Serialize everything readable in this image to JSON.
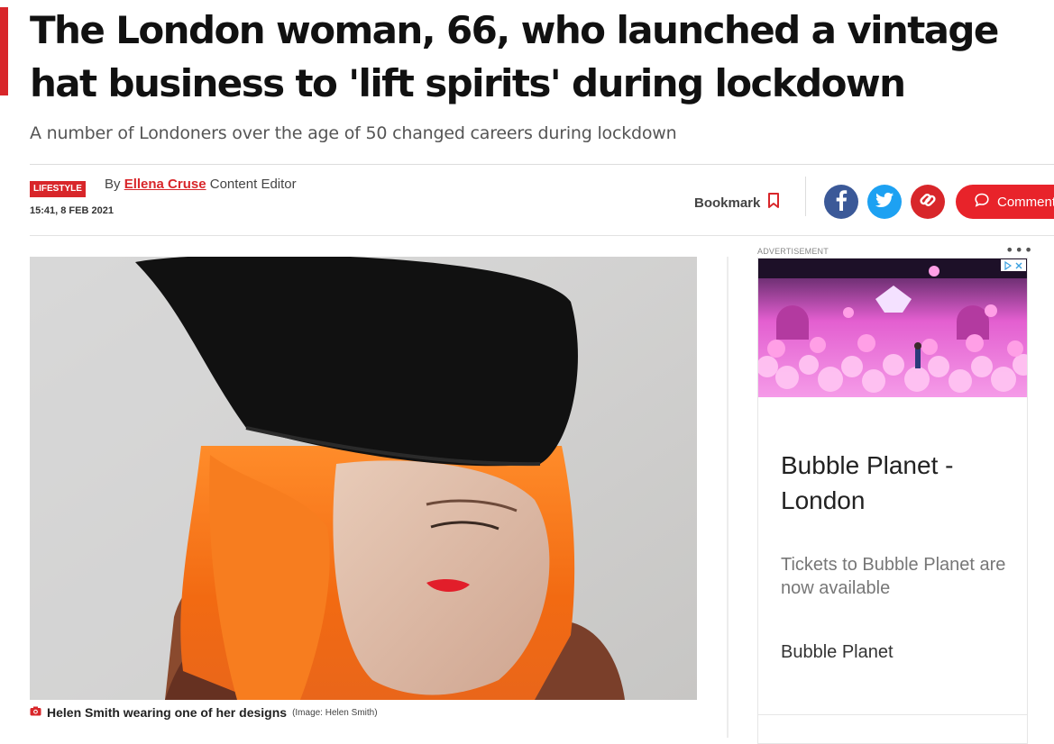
{
  "article": {
    "headline": "The London woman, 66, who launched a vintage hat business to 'lift spirits' during lockdown",
    "standfirst": "A number of Londoners over the age of 50 changed careers during lockdown",
    "section_badge": "LIFESTYLE",
    "byline_prefix": "By",
    "author": "Ellena Cruse",
    "author_role": "Content Editor",
    "timestamp": "15:41, 8 FEB 2021"
  },
  "toolbar": {
    "bookmark_label": "Bookmark",
    "comments_label": "Comments"
  },
  "photo": {
    "caption": "Helen Smith wearing one of her designs",
    "credit": "(Image: Helen Smith)"
  },
  "ad": {
    "label": "ADVERTISEMENT",
    "menu": "•••",
    "title": "Bubble Planet - London",
    "description": "Tickets to Bubble Planet are now available",
    "brand": "Bubble Planet"
  },
  "colors": {
    "brand_red": "#d8262a",
    "facebook": "#3b5998",
    "twitter": "#1da1f2"
  }
}
